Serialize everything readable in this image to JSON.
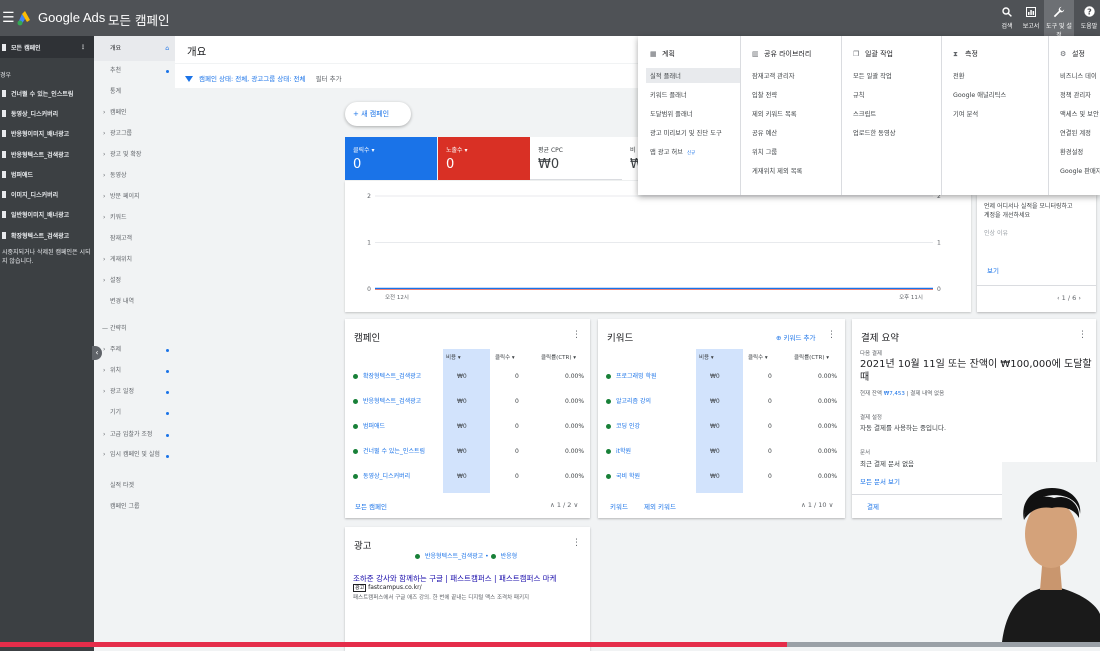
{
  "topbar": {
    "brand": "Google Ads",
    "page_title": "모든 캠페인",
    "tools": [
      {
        "label": "검색",
        "icon": "search-icon"
      },
      {
        "label": "보고서",
        "icon": "reports-icon"
      },
      {
        "label": "도구 및 설정",
        "icon": "wrench-icon"
      },
      {
        "label": "도움말",
        "icon": "help-icon"
      }
    ]
  },
  "leftnav": {
    "all_campaigns": "모든 캠페인",
    "effective_label": "경우",
    "campaigns": [
      "건너뛸 수 있는_인스트림",
      "동영상_디스커버리",
      "반응형이미지_배너광고",
      "반응형텍스트_검색광고",
      "범퍼애드",
      "이미지_디스커버리",
      "일반형이미지_배너광고",
      "확장형텍스트_검색광고"
    ],
    "note": "시중지되거나 삭제된 캠페인은 시되지 않습니다."
  },
  "subnav": {
    "items": [
      "개요",
      "추천",
      "통계",
      "캠페인",
      "광고그룹",
      "광고 및 확장",
      "동영상",
      "방문 페이지",
      "키워드",
      "잠재고객",
      "게재위치",
      "설정",
      "변경 내역"
    ],
    "group_label": "간략히",
    "more_items": [
      "주제",
      "위치",
      "광고 일정",
      "기기",
      "고급 입찰가 조정",
      "임시 캠페인 및 실험",
      "실적 타겟",
      "캠페인 그룹"
    ]
  },
  "overview": {
    "title": "개요",
    "filter_text": "캠페인 상태: 전체, 광고그룹 상태: 전체",
    "add_filter": "필터 추가",
    "new_campaign": "+ 새 캠페인"
  },
  "metrics": [
    {
      "label": "클릭수 ▾",
      "value": "0",
      "color": "#1a73e8"
    },
    {
      "label": "노출수 ▾",
      "value": "0",
      "color": "#d93025"
    },
    {
      "label": "평균 CPC",
      "value": "₩0"
    },
    {
      "label": "비",
      "value": "₩"
    }
  ],
  "chart": {
    "type": "line",
    "x_labels": [
      "오전 12시",
      "오후 11시"
    ],
    "y_ticks_left": [
      "2",
      "1",
      "0"
    ],
    "y_ticks_right": [
      "2",
      "1",
      "0"
    ],
    "series": [
      {
        "values": [
          0,
          0
        ],
        "color": "#d93025"
      },
      {
        "values": [
          0,
          0
        ],
        "color": "#1a73e8"
      }
    ]
  },
  "campaign_card": {
    "title": "캠페인",
    "headers": [
      "비용",
      "클릭수",
      "클릭률(CTR)"
    ],
    "rows": [
      {
        "name": "확장형텍스트_검색광고",
        "cost": "₩0",
        "clicks": "0",
        "ctr": "0.00%"
      },
      {
        "name": "반응형텍스트_검색광고",
        "cost": "₩0",
        "clicks": "0",
        "ctr": "0.00%"
      },
      {
        "name": "범퍼애드",
        "cost": "₩0",
        "clicks": "0",
        "ctr": "0.00%"
      },
      {
        "name": "건너뛸 수 있는_인스트림",
        "cost": "₩0",
        "clicks": "0",
        "ctr": "0.00%"
      },
      {
        "name": "동영상_디스커버리",
        "cost": "₩0",
        "clicks": "0",
        "ctr": "0.00%"
      }
    ],
    "footer": "모든 캠페인",
    "pagination": "1 / 2"
  },
  "keyword_card": {
    "title": "키워드",
    "add": "키워드 추가",
    "headers": [
      "비용",
      "클릭수",
      "클릭률(CTR)"
    ],
    "rows": [
      {
        "name": "프로그래밍 학원",
        "cost": "₩0",
        "clicks": "0",
        "ctr": "0.00%"
      },
      {
        "name": "알고리즘 강의",
        "cost": "₩0",
        "clicks": "0",
        "ctr": "0.00%"
      },
      {
        "name": "코딩 인강",
        "cost": "₩0",
        "clicks": "0",
        "ctr": "0.00%"
      },
      {
        "name": "it학원",
        "cost": "₩0",
        "clicks": "0",
        "ctr": "0.00%"
      },
      {
        "name": "국비 학원",
        "cost": "₩0",
        "clicks": "0",
        "ctr": "0.00%"
      }
    ],
    "footer1": "키워드",
    "footer2": "제외 키워드",
    "pagination": "1 / 10"
  },
  "billing_card": {
    "title": "결제 요약",
    "next_label": "다음 결제",
    "headline": "2021년 10월 11일 또는 잔액이 ₩100,000에 도달할 때",
    "current_balance": "현재 잔액",
    "balance_value": "₩7,453",
    "no_history": "결제 내역 없음",
    "settings_label": "결제 설정",
    "settings_value": "자동 결제를 사용하는 중입니다.",
    "docs_label": "문서",
    "docs_value": "최근 결제 문서 없음",
    "docs_link": "모든 문서 보기",
    "footer": "결제"
  },
  "side_card": {
    "line1": "언제 어디서나 실적을 모니터링하고",
    "line2": "계정을 개선하세요",
    "reason": "인상 이유",
    "link": "보기",
    "pagination": "1 / 6"
  },
  "ads_card": {
    "title": "광고",
    "tags": [
      "반응형텍스트_검색광고",
      "반응형"
    ],
    "ad_headline": "조하준 강사와 함께하는 구글 | 패스트캠퍼스 | 패스트캠퍼스 마케",
    "ad_badge": "광고",
    "ad_url": "fastcampus.co.kr/",
    "ad_desc": "패스트캠퍼스에서 구글 애즈 강의. 한 번에 끝내는 디지털 맥스 조격차 패키지"
  },
  "tools_menu": {
    "columns": [
      {
        "heading": "계획",
        "icon": "calendar-icon",
        "items": [
          "실적 플래너",
          "키워드 플래너",
          "도달범위 플래너",
          "광고 미리보기 및 진단 도구",
          "앱 광고 허브"
        ],
        "badge": "신규"
      },
      {
        "heading": "공유 라이브러리",
        "icon": "library-icon",
        "items": [
          "잠재고객 관리자",
          "입찰 전략",
          "제외 키워드 목록",
          "공유 예산",
          "위치 그룹",
          "게재위치 제외 목록"
        ]
      },
      {
        "heading": "일괄 작업",
        "icon": "copy-icon",
        "items": [
          "모든 일괄 작업",
          "규칙",
          "스크립트",
          "업로드한 동영상"
        ]
      },
      {
        "heading": "측정",
        "icon": "hourglass-icon",
        "items": [
          "전환",
          "Google 애널리틱스",
          "기여 분석"
        ]
      },
      {
        "heading": "설정",
        "icon": "settings-icon",
        "items": [
          "비즈니스 데이",
          "정책 관리자",
          "액세스 및 보안",
          "연결된 계정",
          "환경설정",
          "Google 판매자"
        ]
      }
    ]
  },
  "colors": {
    "accent": "#1a73e8",
    "topbar": "#4f5256",
    "leftnav": "#3c4043",
    "clicks": "#1a73e8",
    "impressions": "#d93025",
    "progress": "#e52d4a"
  },
  "video_progress": 0.715
}
